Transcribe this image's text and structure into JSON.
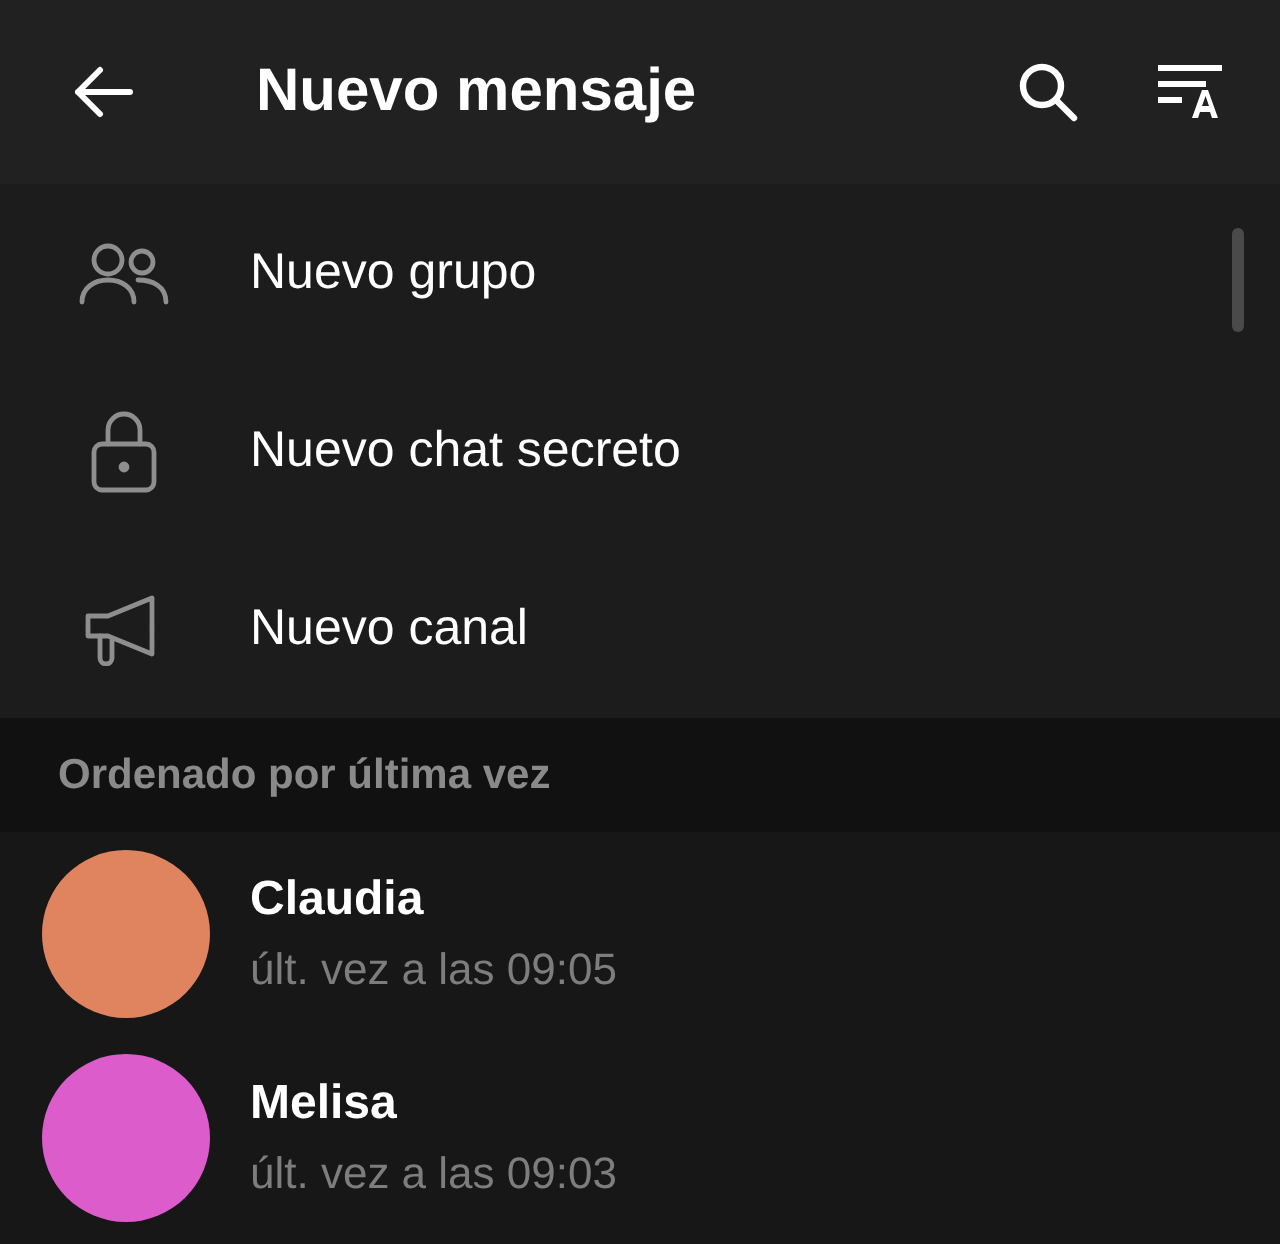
{
  "header": {
    "title": "Nuevo mensaje"
  },
  "actions": [
    {
      "kind": "group",
      "label": "Nuevo grupo"
    },
    {
      "kind": "lock",
      "label": "Nuevo chat secreto"
    },
    {
      "kind": "megaphone",
      "label": "Nuevo canal"
    }
  ],
  "section": {
    "title": "Ordenado por última vez"
  },
  "contacts": [
    {
      "name": "Claudia",
      "status": "últ. vez a las 09:05",
      "color": "#e08460"
    },
    {
      "name": "Melisa",
      "status": "últ. vez a las 09:03",
      "color": "#dc5ccc"
    }
  ]
}
